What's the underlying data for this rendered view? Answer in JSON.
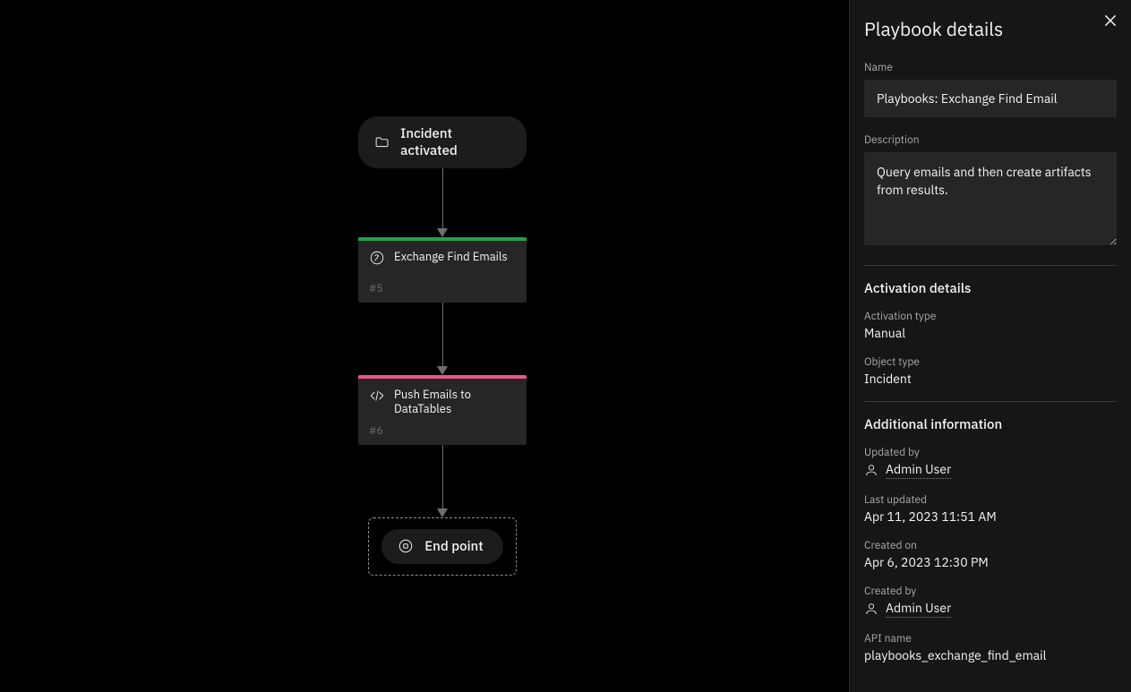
{
  "canvas": {
    "start": {
      "label": "Incident activated"
    },
    "end": {
      "label": "End point"
    },
    "nodes": [
      {
        "title": "Exchange Find Emails",
        "ref": "#5",
        "color": "green",
        "icon": "function"
      },
      {
        "title": "Push Emails to DataTables",
        "ref": "#6",
        "color": "magenta",
        "icon": "code"
      }
    ]
  },
  "panel": {
    "title": "Playbook details",
    "name_label": "Name",
    "name_value": "Playbooks: Exchange Find Email",
    "desc_label": "Description",
    "desc_value": "Query emails and then create artifacts from results.",
    "activation": {
      "heading": "Activation details",
      "type_label": "Activation type",
      "type_value": "Manual",
      "object_label": "Object type",
      "object_value": "Incident"
    },
    "additional": {
      "heading": "Additional information",
      "updated_by_label": "Updated by",
      "updated_by_value": "Admin User",
      "last_updated_label": "Last updated",
      "last_updated_value": "Apr 11, 2023 11:51 AM",
      "created_on_label": "Created on",
      "created_on_value": "Apr 6, 2023 12:30 PM",
      "created_by_label": "Created by",
      "created_by_value": "Admin User",
      "api_name_label": "API name",
      "api_name_value": "playbooks_exchange_find_email"
    }
  }
}
